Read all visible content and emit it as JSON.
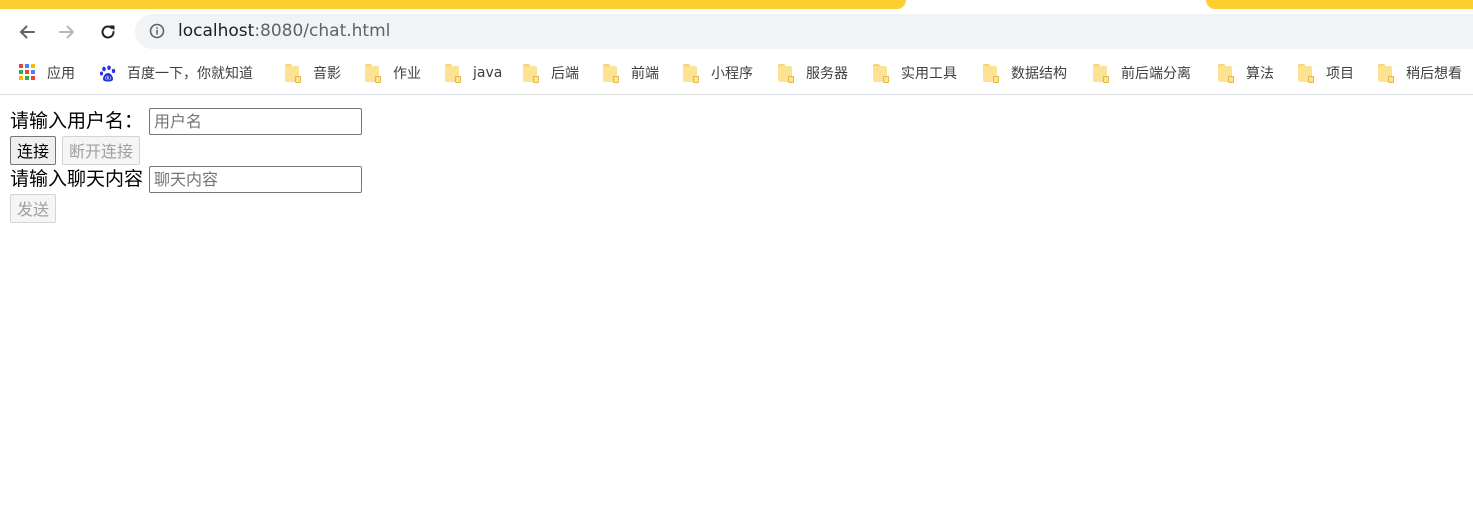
{
  "browser": {
    "url_host": "localhost",
    "url_rest": ":8080/chat.html"
  },
  "bookmarks": [
    {
      "label": "应用",
      "icon": "apps-grid-icon"
    },
    {
      "label": "百度一下，你就知道",
      "icon": "baidu-paw-icon"
    },
    {
      "label": "音影",
      "icon": "folder-icon"
    },
    {
      "label": "作业",
      "icon": "folder-icon"
    },
    {
      "label": "java",
      "icon": "folder-icon"
    },
    {
      "label": "后端",
      "icon": "folder-icon"
    },
    {
      "label": "前端",
      "icon": "folder-icon"
    },
    {
      "label": "小程序",
      "icon": "folder-icon"
    },
    {
      "label": "服务器",
      "icon": "folder-icon"
    },
    {
      "label": "实用工具",
      "icon": "folder-icon"
    },
    {
      "label": "数据结构",
      "icon": "folder-icon"
    },
    {
      "label": "前后端分离",
      "icon": "folder-icon"
    },
    {
      "label": "算法",
      "icon": "folder-icon"
    },
    {
      "label": "项目",
      "icon": "folder-icon"
    },
    {
      "label": "稍后想看",
      "icon": "folder-icon"
    }
  ],
  "form": {
    "username_label": "请输入用户名：",
    "username_placeholder": "用户名",
    "username_value": "",
    "connect_label": "连接",
    "disconnect_label": "断开连接",
    "message_label": "请输入聊天内容",
    "message_placeholder": "聊天内容",
    "message_value": "",
    "send_label": "发送"
  },
  "colors": {
    "tab_accent": "#fecd2f",
    "omnibox_bg": "#f1f3f4",
    "folder": "#fde293",
    "baidu_blue": "#2932e1"
  }
}
